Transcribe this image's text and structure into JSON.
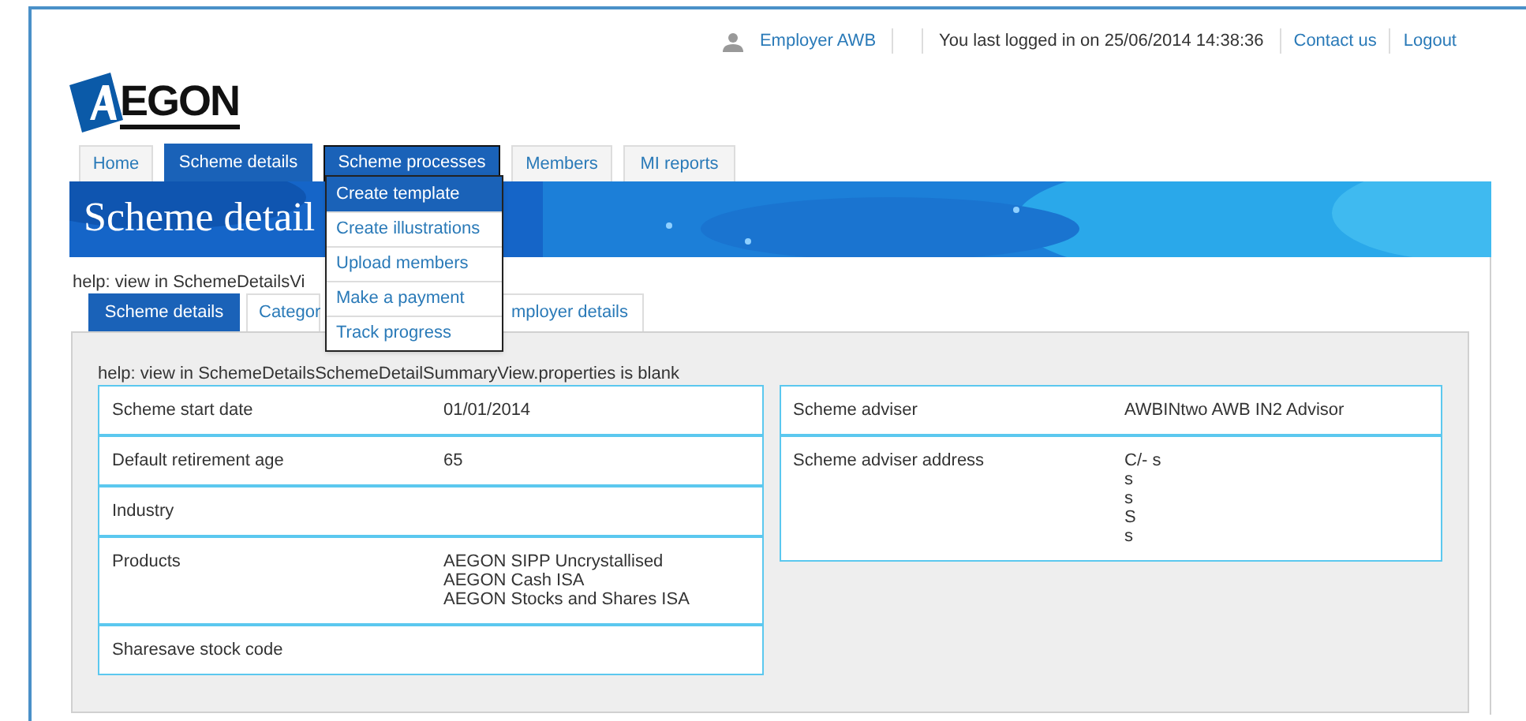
{
  "header": {
    "user": "Employer AWB",
    "last_login": "You last logged in on 25/06/2014 14:38:36",
    "links": [
      "Contact us",
      "Logout"
    ]
  },
  "logo": "EGON",
  "nav": [
    {
      "label": "Home",
      "selected": false
    },
    {
      "label": "Scheme details",
      "selected": true
    },
    {
      "label": "Scheme processes",
      "selected": false,
      "open": true
    },
    {
      "label": "Members",
      "selected": false
    },
    {
      "label": "MI reports",
      "selected": false
    }
  ],
  "dropdown": [
    {
      "label": "Create template",
      "selected": true
    },
    {
      "label": "Create illustrations",
      "selected": false
    },
    {
      "label": "Upload members",
      "selected": false
    },
    {
      "label": "Make a payment",
      "selected": false
    },
    {
      "label": "Track progress",
      "selected": false
    }
  ],
  "banner_title": "Scheme detail",
  "help_top": "help: view in SchemeDetailsVi",
  "subtabs": [
    {
      "label": "Scheme details",
      "selected": true
    },
    {
      "label": "Categor",
      "selected": false
    },
    {
      "label": "mployer details",
      "selected": false
    }
  ],
  "help_panel": "help: view in SchemeDetailsSchemeDetailSummaryView.properties is blank",
  "left_table": [
    {
      "label": "Scheme start date",
      "value": [
        "01/01/2014"
      ]
    },
    {
      "label": "Default retirement age",
      "value": [
        "65"
      ]
    },
    {
      "label": "Industry"
    },
    {
      "label": "Products",
      "value": [
        "AEGON SIPP Uncrystallised",
        "AEGON Cash ISA",
        "AEGON Stocks and Shares ISA"
      ]
    },
    {
      "label": "Sharesave stock code"
    }
  ],
  "right_table": [
    {
      "label": "Scheme adviser",
      "value": [
        "AWBINtwo AWB IN2 Advisor"
      ]
    },
    {
      "label": "Scheme adviser address",
      "value": [
        "C/- s",
        "s",
        "s",
        "S",
        "s"
      ]
    }
  ]
}
